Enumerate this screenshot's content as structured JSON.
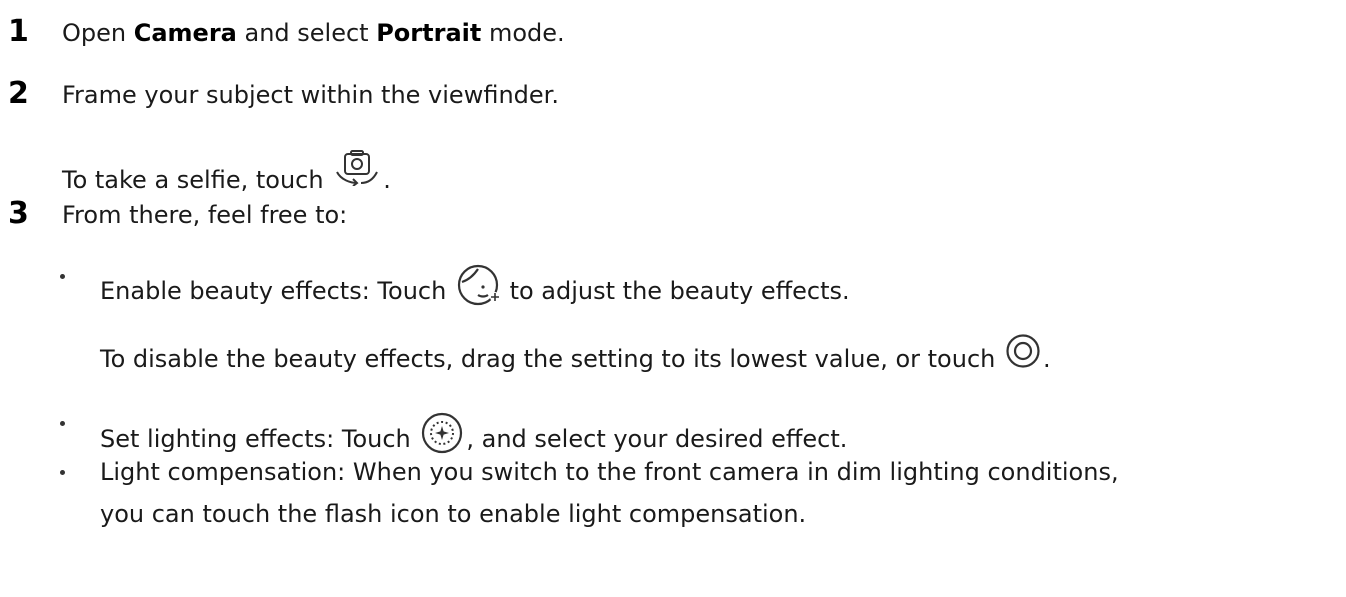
{
  "steps": [
    {
      "number": "1",
      "prefix": "Open ",
      "app": "Camera",
      "middle": " and select ",
      "mode": "Portrait",
      "suffix": " mode."
    },
    {
      "number": "2",
      "text": "Frame your subject within the viewfinder.",
      "note_prefix": "To take a selfie, touch ",
      "note_suffix": "."
    },
    {
      "number": "3",
      "text": "From there, feel free to:"
    }
  ],
  "bullets": {
    "beauty": {
      "prefix": "Enable beauty effects: Touch ",
      "suffix": " to adjust the beauty effects.",
      "disable_prefix": "To disable the beauty effects, drag the setting to its lowest value, or touch ",
      "disable_suffix": "."
    },
    "lighting": {
      "prefix": "Set lighting effects: Touch ",
      "suffix": ", and select your desired effect."
    },
    "compensation": {
      "line1": "Light compensation: When you switch to the front camera in dim lighting conditions,",
      "line2": "you can touch the flash icon to enable light compensation."
    }
  },
  "icons": {
    "switch_camera": "switch-camera-icon",
    "beauty": "beauty-face-icon",
    "disable": "disable-circle-icon",
    "lighting": "lighting-effect-icon"
  }
}
